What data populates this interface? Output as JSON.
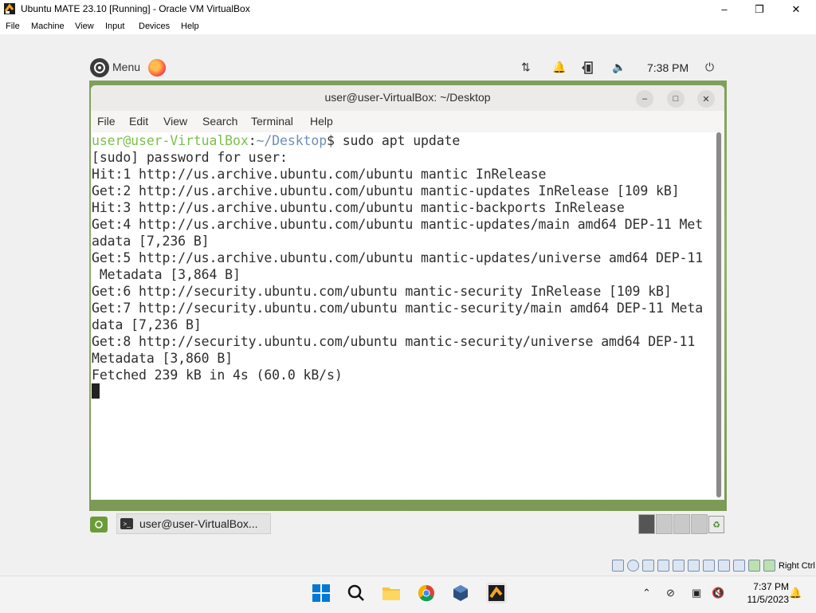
{
  "vbox": {
    "title": "Ubuntu MATE 23.10 [Running] - Oracle VM VirtualBox",
    "menu": [
      "File",
      "Machine",
      "View",
      "Input",
      "Devices",
      "Help"
    ],
    "right_ctrl": "Right Ctrl"
  },
  "mate_panel": {
    "menu_label": "Menu",
    "clock": "7:38 PM"
  },
  "terminal": {
    "title": "user@user-VirtualBox: ~/Desktop",
    "menu": [
      "File",
      "Edit",
      "View",
      "Search",
      "Terminal",
      "Help"
    ],
    "prompt_user": "user@user-VirtualBox",
    "prompt_sep": ":",
    "prompt_path": "~/Desktop",
    "prompt_cmd": "$ sudo apt update",
    "lines": [
      "[sudo] password for user:",
      "Hit:1 http://us.archive.ubuntu.com/ubuntu mantic InRelease",
      "Get:2 http://us.archive.ubuntu.com/ubuntu mantic-updates InRelease [109 kB]",
      "Hit:3 http://us.archive.ubuntu.com/ubuntu mantic-backports InRelease",
      "Get:4 http://us.archive.ubuntu.com/ubuntu mantic-updates/main amd64 DEP-11 Met",
      "adata [7,236 B]",
      "Get:5 http://us.archive.ubuntu.com/ubuntu mantic-updates/universe amd64 DEP-11",
      " Metadata [3,864 B]",
      "Get:6 http://security.ubuntu.com/ubuntu mantic-security InRelease [109 kB]",
      "Get:7 http://security.ubuntu.com/ubuntu mantic-security/main amd64 DEP-11 Meta",
      "data [7,236 B]",
      "Get:8 http://security.ubuntu.com/ubuntu mantic-security/universe amd64 DEP-11",
      "Metadata [3,860 B]",
      "Fetched 239 kB in 4s (60.0 kB/s)"
    ]
  },
  "bottom_panel": {
    "task_label": "user@user-VirtualBox..."
  },
  "windows_taskbar": {
    "time": "7:37 PM",
    "date": "11/5/2023"
  }
}
